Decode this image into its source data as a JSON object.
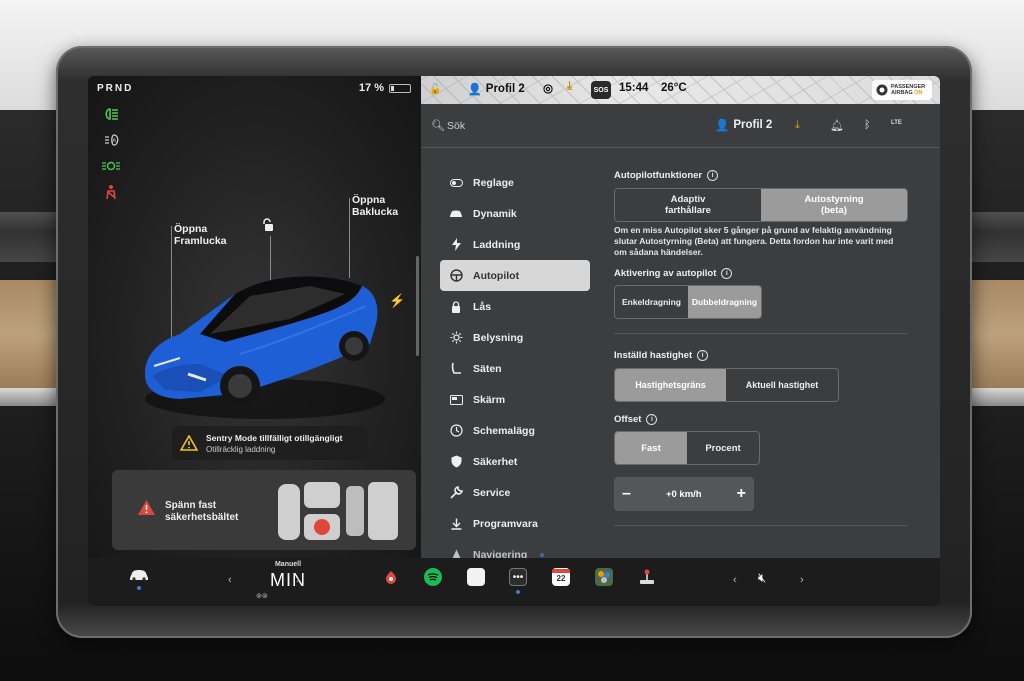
{
  "status": {
    "gear": "PRND",
    "battery_percent": "17 %",
    "battery_level": 0.17
  },
  "car": {
    "frunk_label": "Öppna\nFramlucka",
    "frunk_line1": "Öppna",
    "frunk_line2": "Framlucka",
    "trunk_line1": "Öppna",
    "trunk_line2": "Baklucka",
    "car_color": "#1f5fd6"
  },
  "sentry": {
    "title": "Sentry Mode tillfälligt otillgängligt",
    "subtitle": "Otillräcklig laddning"
  },
  "seatbelt": {
    "line1": "Spänn fast",
    "line2": "säkerhetsbältet"
  },
  "topbar": {
    "profile": "Profil 2",
    "sos": "SOS",
    "time": "15:44",
    "temperature": "26°C",
    "airbag_line1": "PASSENGER",
    "airbag_line2": "AIRBAG",
    "airbag_state": "ON"
  },
  "search": {
    "placeholder": "Sök",
    "profile": "Profil 2",
    "lte": "LTE"
  },
  "menu": {
    "items": [
      {
        "label": "Reglage",
        "icon": "toggle-icon"
      },
      {
        "label": "Dynamik",
        "icon": "car-icon"
      },
      {
        "label": "Laddning",
        "icon": "bolt-icon"
      },
      {
        "label": "Autopilot",
        "icon": "steering-wheel-icon"
      },
      {
        "label": "Lås",
        "icon": "lock-icon"
      },
      {
        "label": "Belysning",
        "icon": "sun-icon"
      },
      {
        "label": "Säten",
        "icon": "seat-icon"
      },
      {
        "label": "Skärm",
        "icon": "display-icon"
      },
      {
        "label": "Schemalägg",
        "icon": "clock-icon"
      },
      {
        "label": "Säkerhet",
        "icon": "shield-icon"
      },
      {
        "label": "Service",
        "icon": "wrench-icon"
      },
      {
        "label": "Programvara",
        "icon": "download-icon"
      },
      {
        "label": "Navigering",
        "icon": "navigation-icon"
      }
    ]
  },
  "autopilot": {
    "features_title": "Autopilotfunktioner",
    "feature_options": [
      "Adaptiv\nfarthållare",
      "Autostyrning\n(beta)"
    ],
    "feature_option_1_line1": "Adaptiv",
    "feature_option_1_line2": "farthållare",
    "feature_option_2_line1": "Autostyrning",
    "feature_option_2_line2": "(beta)",
    "feature_selected": "Autostyrning (beta)",
    "warning_text": "Om en miss Autopilot sker 5 gånger på grund av felaktig användning slutar Autostyrning (Beta) att fungera. Detta fordon har inte varit med om sådana händelser.",
    "activation_title": "Aktivering av autopilot",
    "activation_options": [
      "Enkeldragning",
      "Dubbeldragning"
    ],
    "activation_selected": "Dubbeldragning",
    "speed_title": "Inställd hastighet",
    "speed_options": [
      "Hastighetsgräns",
      "Aktuell hastighet"
    ],
    "speed_selected": "Hastighetsgräns",
    "offset_title": "Offset",
    "offset_options": [
      "Fast",
      "Procent"
    ],
    "offset_selected": "Fast",
    "offset_value": "+0 km/h",
    "minus": "–",
    "plus": "+"
  },
  "dock": {
    "climate_mode": "Manuell",
    "climate_value": "MIN",
    "calendar_day": "22"
  },
  "colors": {
    "accent_blue": "#3d7bd9",
    "warning_red": "#e0463c",
    "warning_yellow": "#f0c419",
    "light_green": "#4ec94e"
  }
}
